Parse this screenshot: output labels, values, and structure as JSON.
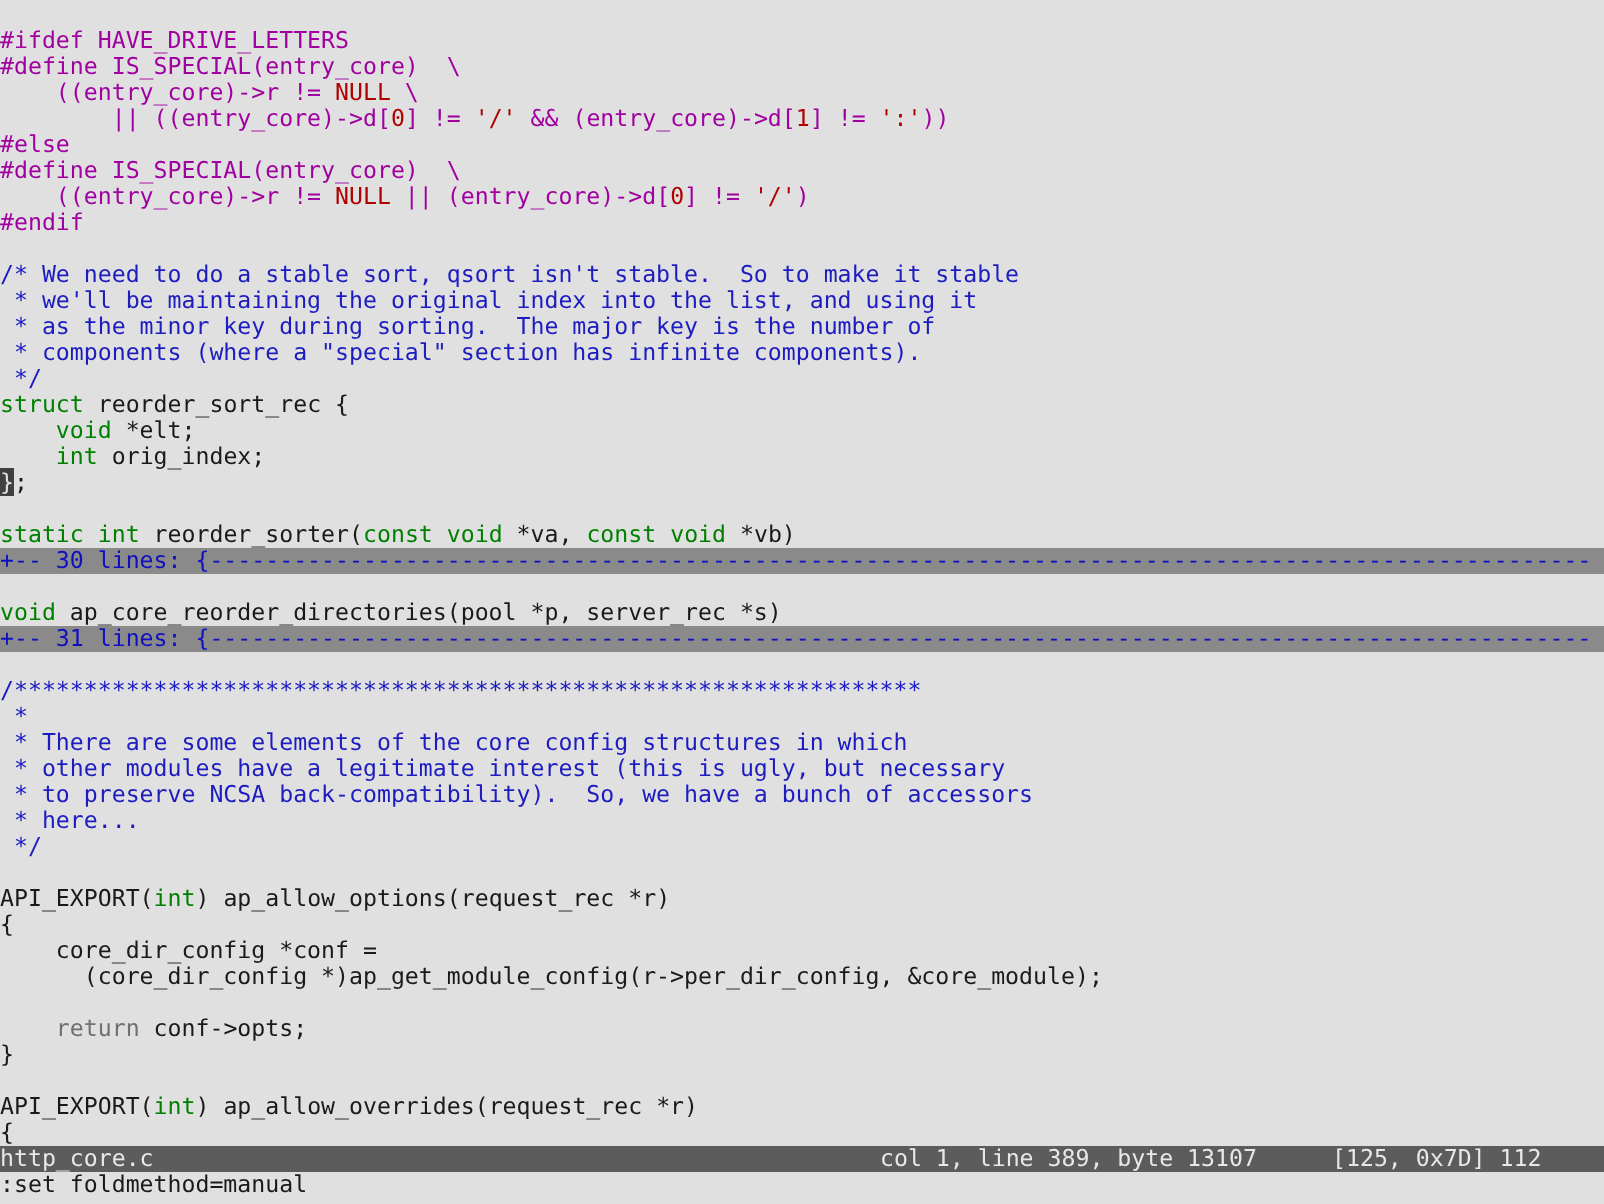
{
  "editor": {
    "lines": [
      {
        "kind": "code",
        "segments": [
          {
            "kind": "preproc",
            "text": "#ifdef HAVE_DRIVE_LETTERS"
          }
        ]
      },
      {
        "kind": "code",
        "segments": [
          {
            "kind": "preproc",
            "text": "#define IS_SPECIAL(entry_core)  \\"
          }
        ]
      },
      {
        "kind": "code",
        "segments": [
          {
            "kind": "preproc",
            "text": "    ((entry_core)->r != "
          },
          {
            "kind": "constant",
            "text": "NULL"
          },
          {
            "kind": "preproc",
            "text": " \\"
          }
        ]
      },
      {
        "kind": "code",
        "segments": [
          {
            "kind": "preproc",
            "text": "        || ((entry_core)->d["
          },
          {
            "kind": "constant",
            "text": "0"
          },
          {
            "kind": "preproc",
            "text": "] != "
          },
          {
            "kind": "constant",
            "text": "'/'"
          },
          {
            "kind": "preproc",
            "text": " && (entry_core)->d["
          },
          {
            "kind": "constant",
            "text": "1"
          },
          {
            "kind": "preproc",
            "text": "] != "
          },
          {
            "kind": "constant",
            "text": "':'"
          },
          {
            "kind": "preproc",
            "text": "))"
          }
        ]
      },
      {
        "kind": "code",
        "segments": [
          {
            "kind": "preproc",
            "text": "#else"
          }
        ]
      },
      {
        "kind": "code",
        "segments": [
          {
            "kind": "preproc",
            "text": "#define IS_SPECIAL(entry_core)  \\"
          }
        ]
      },
      {
        "kind": "code",
        "segments": [
          {
            "kind": "preproc",
            "text": "    ((entry_core)->r != "
          },
          {
            "kind": "constant",
            "text": "NULL"
          },
          {
            "kind": "preproc",
            "text": " || (entry_core)->d["
          },
          {
            "kind": "constant",
            "text": "0"
          },
          {
            "kind": "preproc",
            "text": "] != "
          },
          {
            "kind": "constant",
            "text": "'/'"
          },
          {
            "kind": "preproc",
            "text": ")"
          }
        ]
      },
      {
        "kind": "code",
        "segments": [
          {
            "kind": "preproc",
            "text": "#endif"
          }
        ]
      },
      {
        "kind": "blank"
      },
      {
        "kind": "code",
        "segments": [
          {
            "kind": "comment",
            "text": "/* We need to do a stable sort, qsort isn't stable.  So to make it stable"
          }
        ]
      },
      {
        "kind": "code",
        "segments": [
          {
            "kind": "comment",
            "text": " * we'll be maintaining the original index into the list, and using it"
          }
        ]
      },
      {
        "kind": "code",
        "segments": [
          {
            "kind": "comment",
            "text": " * as the minor key during sorting.  The major key is the number of"
          }
        ]
      },
      {
        "kind": "code",
        "segments": [
          {
            "kind": "comment",
            "text": " * components (where a \"special\" section has infinite components)."
          }
        ]
      },
      {
        "kind": "code",
        "segments": [
          {
            "kind": "comment",
            "text": " */"
          }
        ]
      },
      {
        "kind": "code",
        "segments": [
          {
            "kind": "type",
            "text": "struct"
          },
          {
            "kind": "normal",
            "text": " reorder_sort_rec {"
          }
        ]
      },
      {
        "kind": "code",
        "segments": [
          {
            "kind": "type",
            "text": "    void"
          },
          {
            "kind": "normal",
            "text": " *elt;"
          }
        ]
      },
      {
        "kind": "code",
        "segments": [
          {
            "kind": "type",
            "text": "    int"
          },
          {
            "kind": "normal",
            "text": " orig_index;"
          }
        ]
      },
      {
        "kind": "code",
        "segments": [
          {
            "kind": "cursor",
            "text": "}"
          },
          {
            "kind": "normal",
            "text": ";"
          }
        ]
      },
      {
        "kind": "blank"
      },
      {
        "kind": "code",
        "segments": [
          {
            "kind": "type",
            "text": "static int"
          },
          {
            "kind": "normal",
            "text": " reorder_sorter("
          },
          {
            "kind": "type",
            "text": "const void"
          },
          {
            "kind": "normal",
            "text": " *va, "
          },
          {
            "kind": "type",
            "text": "const void"
          },
          {
            "kind": "normal",
            "text": " *vb)"
          }
        ]
      },
      {
        "kind": "fold",
        "text": "+-- 30 lines: {---------------------------------------------------------------------------------------------------"
      },
      {
        "kind": "blank"
      },
      {
        "kind": "code",
        "segments": [
          {
            "kind": "type",
            "text": "void"
          },
          {
            "kind": "normal",
            "text": " ap_core_reorder_directories(pool *p, server_rec *s)"
          }
        ]
      },
      {
        "kind": "fold",
        "text": "+-- 31 lines: {---------------------------------------------------------------------------------------------------"
      },
      {
        "kind": "blank"
      },
      {
        "kind": "code",
        "segments": [
          {
            "kind": "comment",
            "text": "/*****************************************************************"
          }
        ]
      },
      {
        "kind": "code",
        "segments": [
          {
            "kind": "comment",
            "text": " *"
          }
        ]
      },
      {
        "kind": "code",
        "segments": [
          {
            "kind": "comment",
            "text": " * There are some elements of the core config structures in which"
          }
        ]
      },
      {
        "kind": "code",
        "segments": [
          {
            "kind": "comment",
            "text": " * other modules have a legitimate interest (this is ugly, but necessary"
          }
        ]
      },
      {
        "kind": "code",
        "segments": [
          {
            "kind": "comment",
            "text": " * to preserve NCSA back-compatibility).  So, we have a bunch of accessors"
          }
        ]
      },
      {
        "kind": "code",
        "segments": [
          {
            "kind": "comment",
            "text": " * here..."
          }
        ]
      },
      {
        "kind": "code",
        "segments": [
          {
            "kind": "comment",
            "text": " */"
          }
        ]
      },
      {
        "kind": "blank"
      },
      {
        "kind": "code",
        "segments": [
          {
            "kind": "normal",
            "text": "API_EXPORT("
          },
          {
            "kind": "type",
            "text": "int"
          },
          {
            "kind": "normal",
            "text": ") ap_allow_options(request_rec *r)"
          }
        ]
      },
      {
        "kind": "code",
        "segments": [
          {
            "kind": "normal",
            "text": "{"
          }
        ]
      },
      {
        "kind": "code",
        "segments": [
          {
            "kind": "normal",
            "text": "    core_dir_config *conf ="
          }
        ]
      },
      {
        "kind": "code",
        "segments": [
          {
            "kind": "normal",
            "text": "      (core_dir_config *)ap_get_module_config(r->per_dir_config, &core_module);"
          }
        ]
      },
      {
        "kind": "blank"
      },
      {
        "kind": "code",
        "segments": [
          {
            "kind": "statement",
            "text": "    return"
          },
          {
            "kind": "normal",
            "text": " conf->opts;"
          }
        ]
      },
      {
        "kind": "code",
        "segments": [
          {
            "kind": "normal",
            "text": "}"
          }
        ]
      },
      {
        "kind": "blank"
      },
      {
        "kind": "code",
        "segments": [
          {
            "kind": "normal",
            "text": "API_EXPORT("
          },
          {
            "kind": "type",
            "text": "int"
          },
          {
            "kind": "normal",
            "text": ") ap_allow_overrides(request_rec *r)"
          }
        ]
      },
      {
        "kind": "code",
        "segments": [
          {
            "kind": "normal",
            "text": "{"
          }
        ]
      }
    ]
  },
  "status_bar": {
    "file": "http_core.c",
    "position": "col 1, line 389, byte 13107",
    "char_info": "[125, 0x7D] 112"
  },
  "command_line": ":set foldmethod=manual"
}
